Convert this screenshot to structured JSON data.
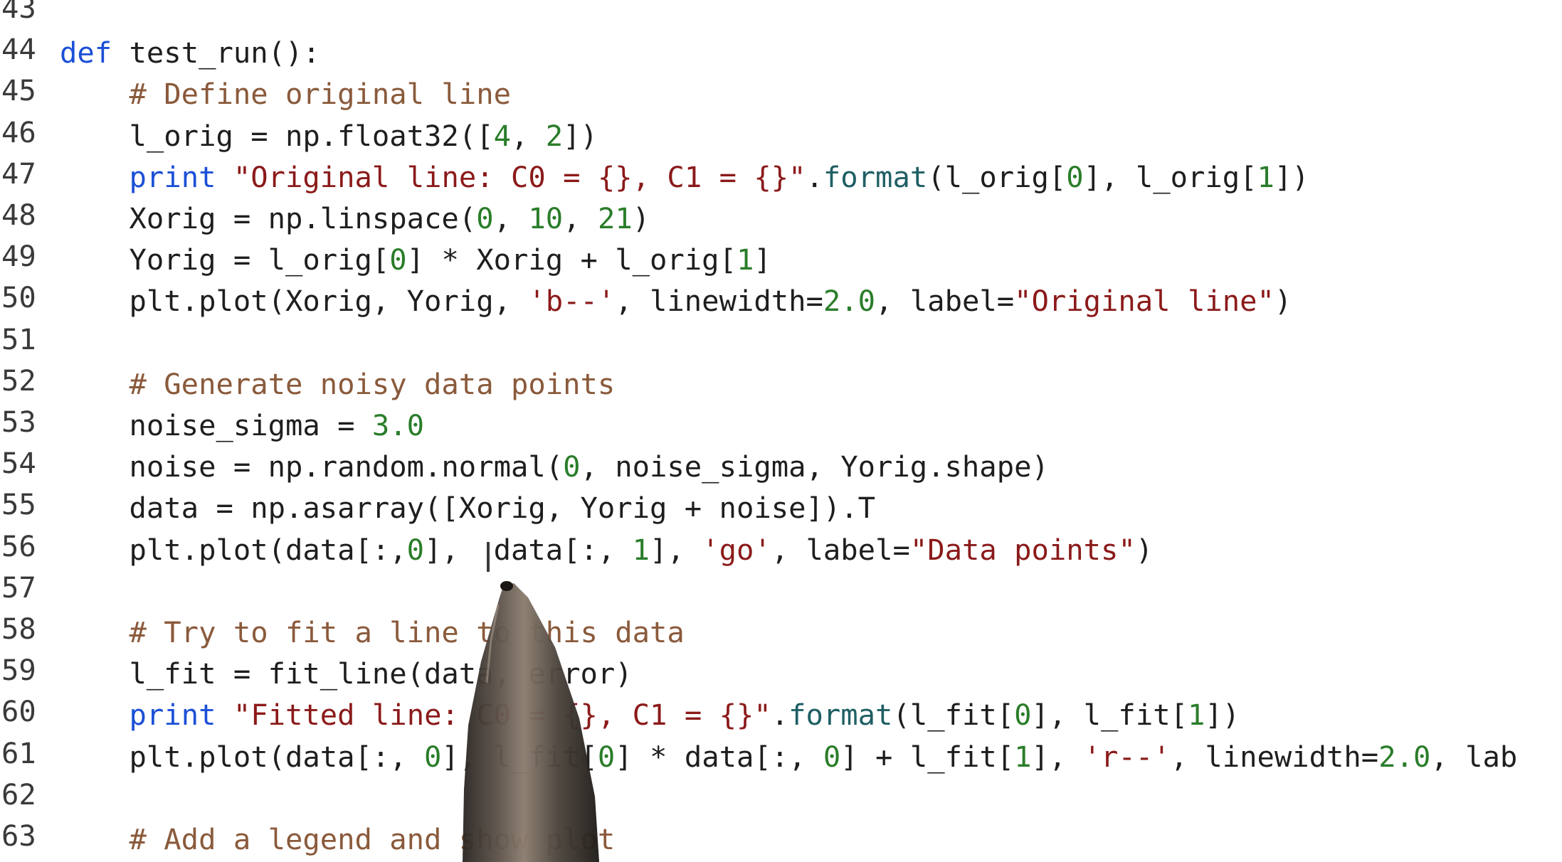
{
  "editor": {
    "lines": [
      {
        "no": "43",
        "tokens": []
      },
      {
        "no": "44",
        "tokens": [
          {
            "t": "def",
            "c": "kw"
          },
          {
            "t": " test_run():",
            "c": "plain"
          }
        ]
      },
      {
        "no": "45",
        "tokens": [
          {
            "t": "    # Define original line",
            "c": "com"
          }
        ]
      },
      {
        "no": "46",
        "tokens": [
          {
            "t": "    l_orig = np.float32([",
            "c": "plain"
          },
          {
            "t": "4",
            "c": "num"
          },
          {
            "t": ", ",
            "c": "plain"
          },
          {
            "t": "2",
            "c": "num"
          },
          {
            "t": "])",
            "c": "plain"
          }
        ]
      },
      {
        "no": "47",
        "tokens": [
          {
            "t": "    ",
            "c": "plain"
          },
          {
            "t": "print",
            "c": "kw"
          },
          {
            "t": " ",
            "c": "plain"
          },
          {
            "t": "\"Original line: C0 = {}, C1 = {}\"",
            "c": "str"
          },
          {
            "t": ".",
            "c": "plain"
          },
          {
            "t": "format",
            "c": "meth"
          },
          {
            "t": "(l_orig[",
            "c": "plain"
          },
          {
            "t": "0",
            "c": "num"
          },
          {
            "t": "], l_orig[",
            "c": "plain"
          },
          {
            "t": "1",
            "c": "num"
          },
          {
            "t": "])",
            "c": "plain"
          }
        ]
      },
      {
        "no": "48",
        "tokens": [
          {
            "t": "    Xorig = np.linspace(",
            "c": "plain"
          },
          {
            "t": "0",
            "c": "num"
          },
          {
            "t": ", ",
            "c": "plain"
          },
          {
            "t": "10",
            "c": "num"
          },
          {
            "t": ", ",
            "c": "plain"
          },
          {
            "t": "21",
            "c": "num"
          },
          {
            "t": ")",
            "c": "plain"
          }
        ]
      },
      {
        "no": "49",
        "tokens": [
          {
            "t": "    Yorig = l_orig[",
            "c": "plain"
          },
          {
            "t": "0",
            "c": "num"
          },
          {
            "t": "] * Xorig + l_orig[",
            "c": "plain"
          },
          {
            "t": "1",
            "c": "num"
          },
          {
            "t": "]",
            "c": "plain"
          }
        ]
      },
      {
        "no": "50",
        "tokens": [
          {
            "t": "    plt.plot(Xorig, Yorig, ",
            "c": "plain"
          },
          {
            "t": "'b--'",
            "c": "str"
          },
          {
            "t": ", linewidth=",
            "c": "plain"
          },
          {
            "t": "2.0",
            "c": "num"
          },
          {
            "t": ", label=",
            "c": "plain"
          },
          {
            "t": "\"Original line\"",
            "c": "str"
          },
          {
            "t": ")",
            "c": "plain"
          }
        ]
      },
      {
        "no": "51",
        "tokens": []
      },
      {
        "no": "52",
        "tokens": [
          {
            "t": "    # Generate noisy data points",
            "c": "com"
          }
        ]
      },
      {
        "no": "53",
        "tokens": [
          {
            "t": "    noise_sigma = ",
            "c": "plain"
          },
          {
            "t": "3.0",
            "c": "num"
          }
        ]
      },
      {
        "no": "54",
        "tokens": [
          {
            "t": "    noise = np.random.normal(",
            "c": "plain"
          },
          {
            "t": "0",
            "c": "num"
          },
          {
            "t": ", noise_sigma, Yorig.shape)",
            "c": "plain"
          }
        ]
      },
      {
        "no": "55",
        "tokens": [
          {
            "t": "    data = np.asarray([Xorig, Yorig + noise]).T",
            "c": "plain"
          }
        ]
      },
      {
        "no": "56",
        "tokens": [
          {
            "t": "    plt.plot(data[:,",
            "c": "plain"
          },
          {
            "t": "0",
            "c": "num"
          },
          {
            "t": "],  data[:, ",
            "c": "plain"
          },
          {
            "t": "1",
            "c": "num"
          },
          {
            "t": "], ",
            "c": "plain"
          },
          {
            "t": "'go'",
            "c": "str"
          },
          {
            "t": ", label=",
            "c": "plain"
          },
          {
            "t": "\"Data points\"",
            "c": "str"
          },
          {
            "t": ")",
            "c": "plain"
          }
        ]
      },
      {
        "no": "57",
        "tokens": []
      },
      {
        "no": "58",
        "tokens": [
          {
            "t": "    # Try to fit a line to this data",
            "c": "com"
          }
        ]
      },
      {
        "no": "59",
        "tokens": [
          {
            "t": "    l_fit = fit_line(data, error)",
            "c": "plain"
          }
        ]
      },
      {
        "no": "60",
        "tokens": [
          {
            "t": "    ",
            "c": "plain"
          },
          {
            "t": "print",
            "c": "kw"
          },
          {
            "t": " ",
            "c": "plain"
          },
          {
            "t": "\"Fitted line: C0 = {}, C1 = {}\"",
            "c": "str"
          },
          {
            "t": ".",
            "c": "plain"
          },
          {
            "t": "format",
            "c": "meth"
          },
          {
            "t": "(l_fit[",
            "c": "plain"
          },
          {
            "t": "0",
            "c": "num"
          },
          {
            "t": "], l_fit[",
            "c": "plain"
          },
          {
            "t": "1",
            "c": "num"
          },
          {
            "t": "])",
            "c": "plain"
          }
        ]
      },
      {
        "no": "61",
        "tokens": [
          {
            "t": "    plt.plot(data[:, ",
            "c": "plain"
          },
          {
            "t": "0",
            "c": "num"
          },
          {
            "t": "], l_fit[",
            "c": "plain"
          },
          {
            "t": "0",
            "c": "num"
          },
          {
            "t": "] * data[:, ",
            "c": "plain"
          },
          {
            "t": "0",
            "c": "num"
          },
          {
            "t": "] + l_fit[",
            "c": "plain"
          },
          {
            "t": "1",
            "c": "num"
          },
          {
            "t": "], ",
            "c": "plain"
          },
          {
            "t": "'r--'",
            "c": "str"
          },
          {
            "t": ", linewidth=",
            "c": "plain"
          },
          {
            "t": "2.0",
            "c": "num"
          },
          {
            "t": ", lab",
            "c": "plain"
          }
        ]
      },
      {
        "no": "62",
        "tokens": []
      },
      {
        "no": "63",
        "tokens": [
          {
            "t": "    # Add a legend and show plot",
            "c": "com"
          }
        ]
      }
    ]
  }
}
